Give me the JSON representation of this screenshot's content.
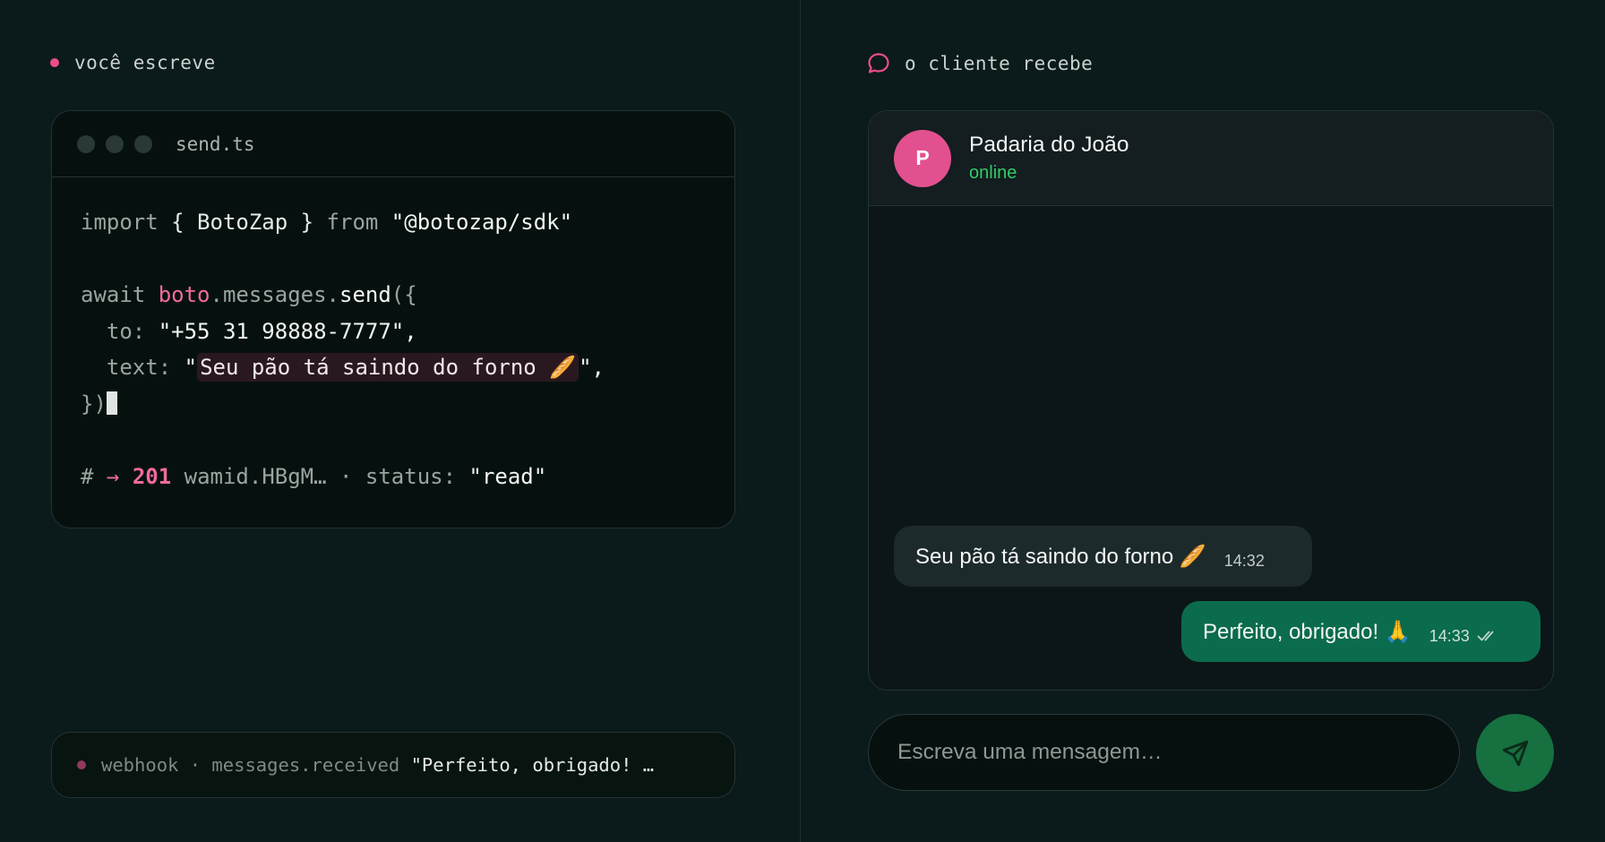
{
  "left": {
    "label": "você escreve",
    "editor": {
      "file_name": "send.ts",
      "line1": {
        "kw1": "import",
        "p1": " { BotoZap } ",
        "kw2": "from",
        "str": " \"@botozap/sdk\""
      },
      "line2": {
        "kw": "await",
        "obj": " boto",
        "rest": ".messages.",
        "fn": "send",
        "tail": "({"
      },
      "line3": {
        "key": "  to:",
        "value": " \"+55 31 98888-7777\","
      },
      "line4": {
        "key": "  text:",
        "open": " \"",
        "value": "Seu pão tá saindo do forno 🥖",
        "close": "\","
      },
      "line5": {
        "text": "})"
      },
      "line6": {
        "hash": "#",
        "arrow": " → ",
        "code": "201",
        "rest": " wamid.HBgM… · status:",
        "status": " \"read\""
      }
    },
    "webhook": {
      "label": "webhook · messages.received",
      "text": " \"Perfeito, obrigado! …"
    }
  },
  "right": {
    "label": "o cliente recebe",
    "contact": {
      "initial": "P",
      "name": "Padaria do João",
      "status": "online"
    },
    "messages": [
      {
        "text": "Seu pão tá saindo do forno 🥖",
        "time": "14:32",
        "direction": "in"
      },
      {
        "text": "Perfeito, obrigado! 🙏",
        "time": "14:33",
        "direction": "out",
        "read": true
      }
    ],
    "compose_placeholder": "Escreva uma mensagem…"
  },
  "colors": {
    "accent_pink": "#ec4d8b",
    "online_green": "#33cc66",
    "outgoing_bubble": "#0b6b4d",
    "send_button": "#16703f"
  },
  "icons": [
    "chat-bubble-icon",
    "double-check-icon",
    "send-icon"
  ]
}
